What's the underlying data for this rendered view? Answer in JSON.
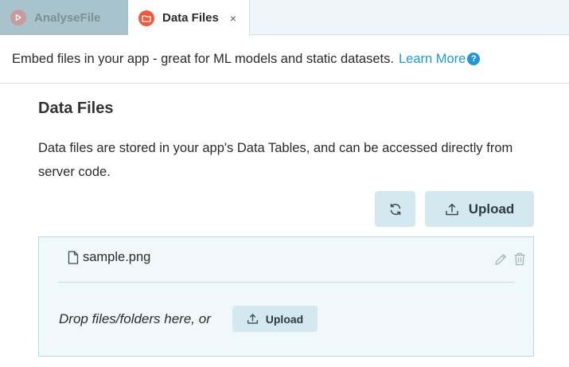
{
  "tabs": [
    {
      "label": "AnalyseFile",
      "active": false
    },
    {
      "label": "Data Files",
      "active": true,
      "close": "×"
    }
  ],
  "info": {
    "text": "Embed files in your app - great for ML models and static datasets.",
    "link": "Learn More",
    "help": "?"
  },
  "section": {
    "title": "Data Files",
    "description": "Data files are stored in your app's Data Tables, and can be accessed directly from server code."
  },
  "toolbar": {
    "upload_label": "Upload"
  },
  "files": [
    {
      "name": "sample.png"
    }
  ],
  "dropzone": {
    "text": "Drop files/folders here, or",
    "upload_label": "Upload"
  },
  "colors": {
    "accent": "#1f9bd1",
    "button_bg": "#d4e9ef",
    "filelist_bg": "#f0f8fb",
    "tab_active_icon": "#f05a3c"
  }
}
